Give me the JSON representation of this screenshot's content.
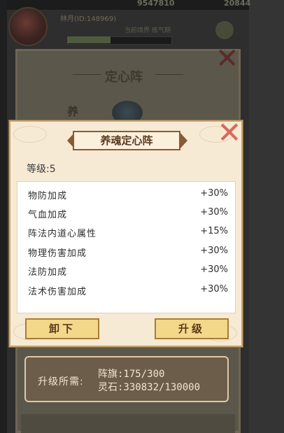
{
  "background": {
    "top_numbers": [
      "9547810",
      "20844"
    ],
    "player_name": "林月(ID:148969)",
    "player_sub": "当前境界 练气期",
    "panel_title": "定心阵",
    "side_char": "养"
  },
  "popup": {
    "title": "养魂定心阵",
    "level_label": "等级:5",
    "stats": [
      {
        "label": "物防加成",
        "value": "+30%"
      },
      {
        "label": "气血加成",
        "value": "+30%"
      },
      {
        "label": "阵法内道心属性",
        "value": "+15%"
      },
      {
        "label": "物理伤害加成",
        "value": "+30%"
      },
      {
        "label": "法防加成",
        "value": "+30%"
      },
      {
        "label": "法术伤害加成",
        "value": "+30%"
      }
    ],
    "buttons": {
      "unload": "卸下",
      "upgrade": "升级"
    },
    "close_icon": "close-x"
  },
  "requirement": {
    "label": "升级所需:",
    "lines": [
      "阵旗:175/300",
      "灵石:330832/130000"
    ]
  },
  "colors": {
    "popup_bg": "#f6ead4",
    "button_gold": "#f4d88a",
    "close_red": "#d76b5c",
    "req_bg": "#6b5d49"
  }
}
